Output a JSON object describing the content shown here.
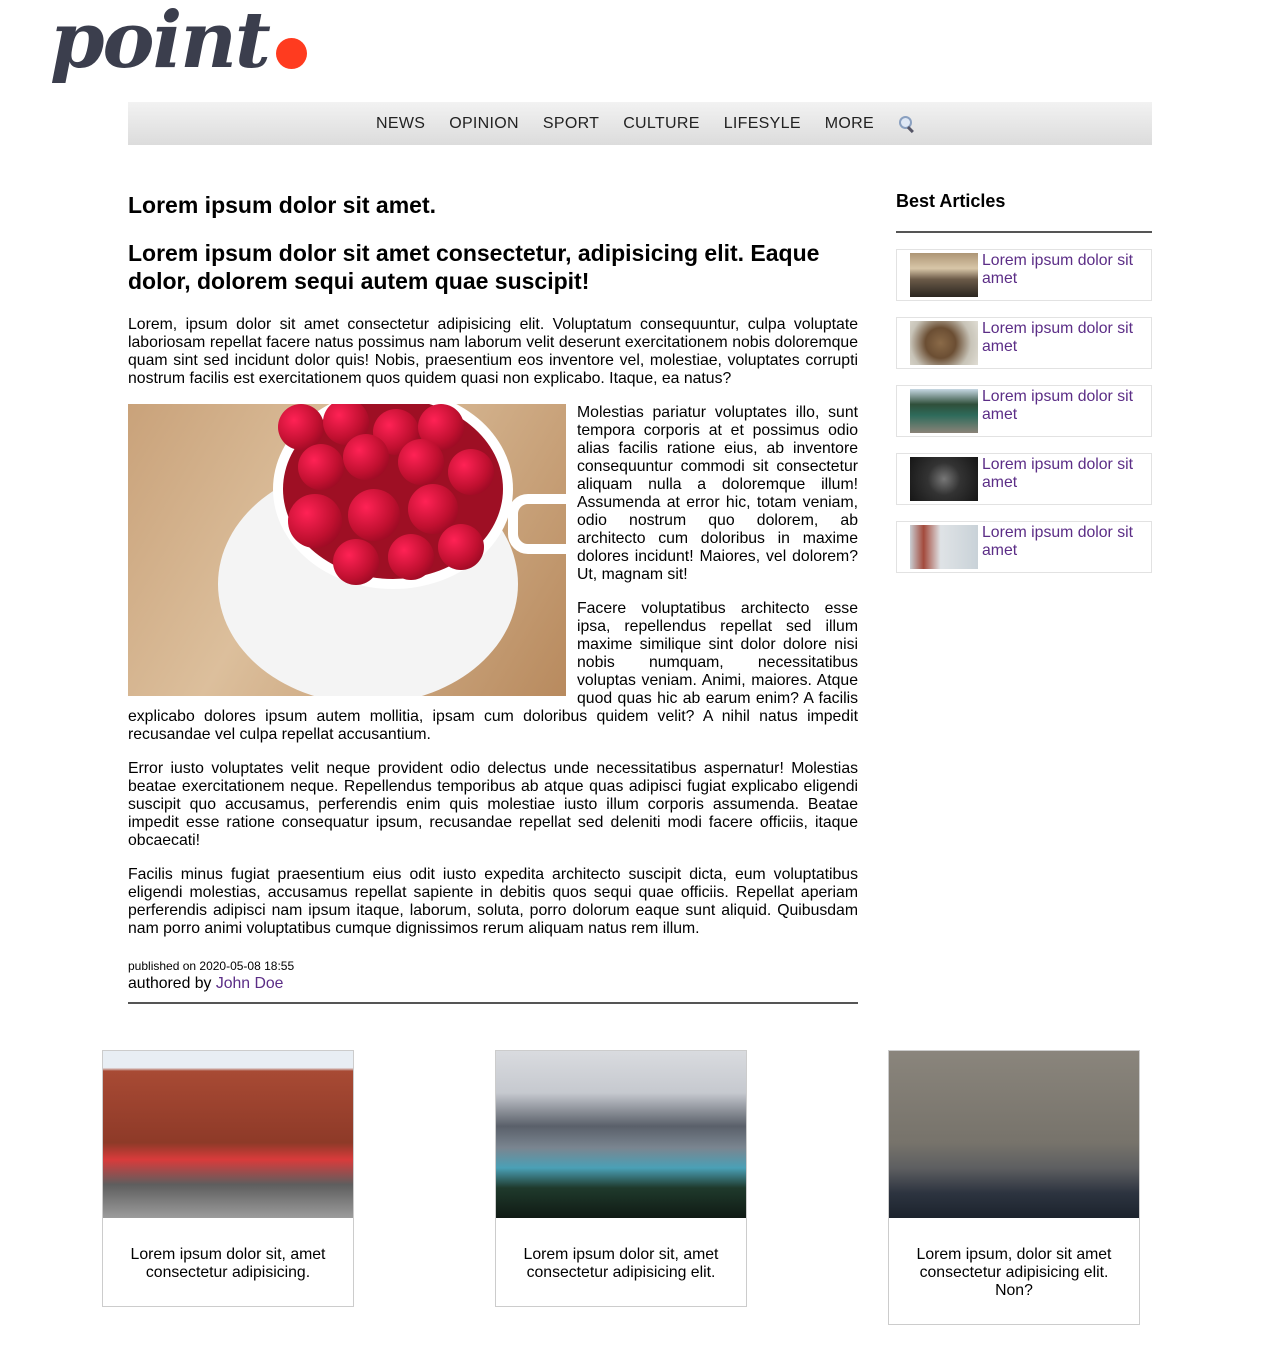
{
  "logo": {
    "text": "point",
    "dot_color": "#ff3b1f",
    "text_color": "#3b3e4d"
  },
  "nav": {
    "items": [
      "NEWS",
      "OPINION",
      "SPORT",
      "CULTURE",
      "LIFESYLE",
      "MORE"
    ],
    "search_icon": "search-icon"
  },
  "article": {
    "title": "Lorem ipsum dolor sit amet.",
    "subtitle": "Lorem ipsum dolor sit amet consectetur, adipisicing elit. Eaque dolor, dolorem sequi autem quae suscipit!",
    "paragraphs": [
      "Lorem, ipsum dolor sit amet consectetur adipisicing elit. Voluptatum consequuntur, culpa voluptate laboriosam repellat facere natus possimus nam laborum velit deserunt exercitationem nobis doloremque quam sint sed incidunt dolor quis! Nobis, praesentium eos inventore vel, molestiae, voluptates corrupti nostrum facilis est exercitationem quos quidem quasi non explicabo. Itaque, ea natus?",
      "Molestias pariatur voluptates illo, sunt tempora corporis at et possimus odio alias facilis ratione eius, ab inventore consequuntur commodi sit consectetur aliquam nulla a doloremque illum! Assumenda at error hic, totam veniam, odio nostrum quo dolorem, ab architecto cum doloribus in maxime dolores incidunt! Maiores, vel dolorem? Ut, magnam sit!",
      "Facere voluptatibus architecto esse ipsa, repellendus repellat sed illum maxime similique sint dolor dolore nisi nobis numquam, necessitatibus voluptas veniam. Animi, maiores. Atque quod quas hic ab earum enim? A facilis explicabo dolores ipsum autem mollitia, ipsam cum doloribus quidem velit? A nihil natus impedit recusandae vel culpa repellat accusantium.",
      "Error iusto voluptates velit neque provident odio delectus unde necessitatibus aspernatur! Molestias beatae exercitationem neque. Repellendus temporibus ab atque quas adipisci fugiat explicabo eligendi suscipit quo accusamus, perferendis enim quis molestiae iusto illum corporis assumenda. Beatae impedit esse ratione consequatur ipsum, recusandae repellat sed deleniti modi facere officiis, itaque obcaecati!",
      "Facilis minus fugiat praesentium eius odit iusto expedita architecto suscipit dicta, eum voluptatibus eligendi molestias, accusamus repellat sapiente in debitis quos sequi quae officiis. Repellat aperiam perferendis adipisci nam ipsum itaque, laborum, soluta, porro dolorum eaque sunt aliquid. Quibusdam nam porro animi voluptatibus cumque dignissimos rerum aliquam natus rem illum."
    ],
    "published": "published on 2020-05-08 18:55",
    "authored_prefix": "authored by",
    "author": "John Doe",
    "link_color": "#5b2d86"
  },
  "sidebar": {
    "title": "Best Articles",
    "items": [
      {
        "label": "Lorem ipsum dolor sit amet"
      },
      {
        "label": "Lorem ipsum dolor sit amet"
      },
      {
        "label": "Lorem ipsum dolor sit amet"
      },
      {
        "label": "Lorem ipsum dolor sit amet"
      },
      {
        "label": "Lorem ipsum dolor sit amet"
      }
    ]
  },
  "cards": [
    {
      "caption": "Lorem ipsum dolor sit, amet consectetur adipisicing."
    },
    {
      "caption": "Lorem ipsum dolor sit, amet consectetur adipisicing elit."
    },
    {
      "caption": "Lorem ipsum, dolor sit amet consectetur adipisicing elit. Non?"
    }
  ]
}
